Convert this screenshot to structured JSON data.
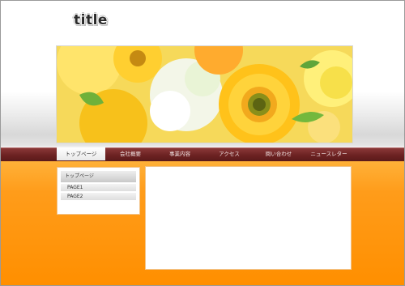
{
  "header": {
    "title": "title"
  },
  "nav": {
    "items": [
      {
        "label": "トップページ",
        "active": true
      },
      {
        "label": "会社概要",
        "active": false
      },
      {
        "label": "事業内容",
        "active": false
      },
      {
        "label": "アクセス",
        "active": false
      },
      {
        "label": "問い合わせ",
        "active": false
      },
      {
        "label": "ニュースレター",
        "active": false
      }
    ]
  },
  "sidebar": {
    "heading": "トップページ",
    "items": [
      {
        "label": "PAGE1"
      },
      {
        "label": "PAGE2"
      }
    ]
  },
  "colors": {
    "accent_orange": "#ff9c1a",
    "nav_maroon": "#6c2222",
    "nav_text": "#f3e6e6"
  },
  "hero": {
    "image_subject": "yellow gerbera and white flowers bouquet"
  }
}
